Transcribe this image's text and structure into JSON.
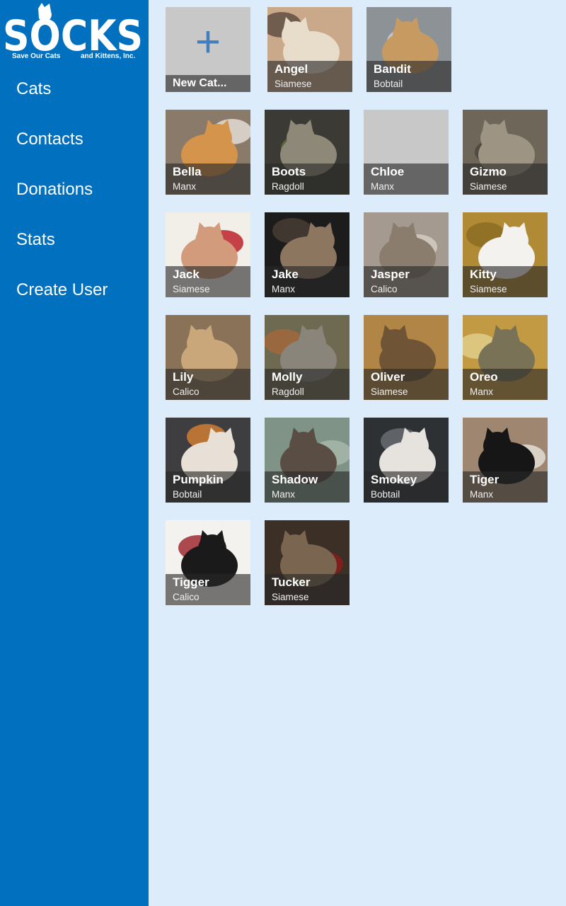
{
  "app": {
    "logo_text": "SOCKS",
    "logo_tagline_left": "Save Our Cats",
    "logo_tagline_right": "and Kittens, Inc.",
    "brand_color": "#0070bf",
    "background_color": "#ddecfb"
  },
  "sidebar": {
    "items": [
      {
        "label": "Cats"
      },
      {
        "label": "Contacts"
      },
      {
        "label": "Donations"
      },
      {
        "label": "Stats"
      },
      {
        "label": "Create User"
      }
    ]
  },
  "new_cat": {
    "label": "New Cat...",
    "icon": "plus-icon"
  },
  "cats": [
    {
      "name": "Angel",
      "breed": "Siamese",
      "photo": {
        "bg": "#caa98a",
        "subject": "#e8dccb",
        "accent": "#5a4a3e"
      }
    },
    {
      "name": "Bandit",
      "breed": "Bobtail",
      "photo": {
        "bg": "#8c9296",
        "subject": "#c79a62",
        "accent": "#cfcfcf"
      }
    },
    {
      "name": "Bella",
      "breed": "Manx",
      "photo": {
        "bg": "#8a7a6a",
        "subject": "#d5944c",
        "accent": "#e9e4dc"
      }
    },
    {
      "name": "Boots",
      "breed": "Ragdoll",
      "photo": {
        "bg": "#3c3a34",
        "subject": "#8e8878",
        "accent": "#5c6d3a"
      }
    },
    {
      "name": "Chloe",
      "breed": "Manx",
      "photo": {
        "bg": "#c8c8c8",
        "subject": "#c8c8c8",
        "accent": "#c8c8c8"
      }
    },
    {
      "name": "Gizmo",
      "breed": "Siamese",
      "photo": {
        "bg": "#6f665a",
        "subject": "#9e9484",
        "accent": "#4a443b"
      }
    },
    {
      "name": "Jack",
      "breed": "Siamese",
      "photo": {
        "bg": "#f2efe9",
        "subject": "#d29b7c",
        "accent": "#b8161e"
      }
    },
    {
      "name": "Jake",
      "breed": "Manx",
      "photo": {
        "bg": "#1c1c1c",
        "subject": "#8d7660",
        "accent": "#4a3f36"
      }
    },
    {
      "name": "Jasper",
      "breed": "Calico",
      "photo": {
        "bg": "#a49a8f",
        "subject": "#8b7d6e",
        "accent": "#d7d0c6"
      }
    },
    {
      "name": "Kitty",
      "breed": "Siamese",
      "photo": {
        "bg": "#b08a34",
        "subject": "#f4f2ee",
        "accent": "#8a6a22"
      }
    },
    {
      "name": "Lily",
      "breed": "Calico",
      "photo": {
        "bg": "#8a7258",
        "subject": "#c9a77a",
        "accent": "#7a3f22"
      }
    },
    {
      "name": "Molly",
      "breed": "Ragdoll",
      "photo": {
        "bg": "#6e6a52",
        "subject": "#8a857a",
        "accent": "#a5683a"
      }
    },
    {
      "name": "Oliver",
      "breed": "Siamese",
      "photo": {
        "bg": "#b08545",
        "subject": "#6f5535",
        "accent": "#2b2218"
      }
    },
    {
      "name": "Oreo",
      "breed": "Manx",
      "photo": {
        "bg": "#c39a44",
        "subject": "#7a7256",
        "accent": "#e2cf8f"
      }
    },
    {
      "name": "Pumpkin",
      "breed": "Bobtail",
      "photo": {
        "bg": "#3e3d40",
        "subject": "#e8e0d6",
        "accent": "#d88232"
      }
    },
    {
      "name": "Shadow",
      "breed": "Manx",
      "photo": {
        "bg": "#7f9486",
        "subject": "#5a4e44",
        "accent": "#a9b9ab"
      }
    },
    {
      "name": "Smokey",
      "breed": "Bobtail",
      "photo": {
        "bg": "#2e3134",
        "subject": "#e6e3de",
        "accent": "#6b7075"
      }
    },
    {
      "name": "Tiger",
      "breed": "Manx",
      "photo": {
        "bg": "#9f8670",
        "subject": "#161616",
        "accent": "#e8e4dc"
      }
    },
    {
      "name": "Tigger",
      "breed": "Calico",
      "photo": {
        "bg": "#f4f2ef",
        "subject": "#1a1a1a",
        "accent": "#9a1e26"
      }
    },
    {
      "name": "Tucker",
      "breed": "Siamese",
      "photo": {
        "bg": "#3c2f25",
        "subject": "#7a6650",
        "accent": "#8c1c1c"
      }
    }
  ]
}
